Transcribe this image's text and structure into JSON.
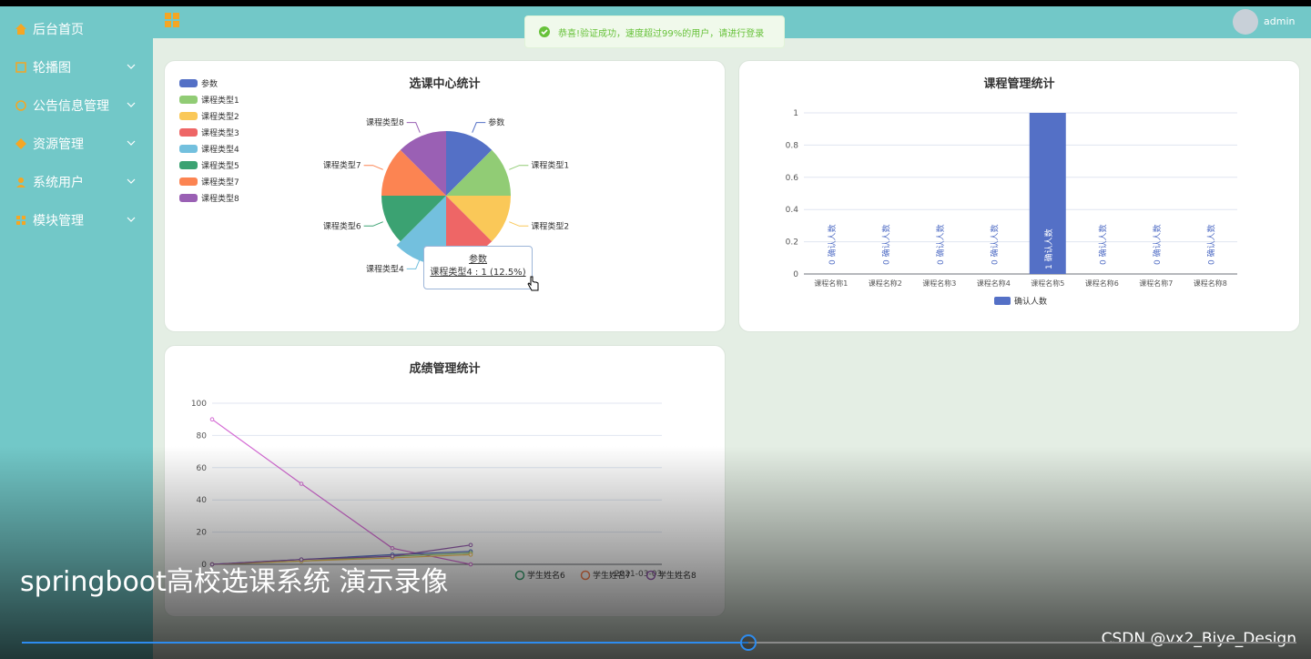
{
  "sidebar": {
    "items": [
      {
        "label": "后台首页",
        "icon": "home-icon",
        "color": "#f5a623",
        "has_chevron": false
      },
      {
        "label": "轮播图",
        "icon": "image-icon",
        "color": "#f5a623",
        "has_chevron": true
      },
      {
        "label": "公告信息管理",
        "icon": "notice-icon",
        "color": "#f5a623",
        "has_chevron": true
      },
      {
        "label": "资源管理",
        "icon": "resource-icon",
        "color": "#f5a623",
        "has_chevron": true
      },
      {
        "label": "系统用户",
        "icon": "user-icon",
        "color": "#f5a623",
        "has_chevron": true
      },
      {
        "label": "模块管理",
        "icon": "module-icon",
        "color": "#f5a623",
        "has_chevron": true
      }
    ]
  },
  "topbar": {
    "user": "admin"
  },
  "toast": {
    "text": "恭喜!验证成功，速度超过99%的用户，请进行登录"
  },
  "charts": {
    "pie": {
      "title": "选课中心统计"
    },
    "bar": {
      "title": "课程管理统计"
    },
    "line": {
      "title": "成绩管理统计"
    }
  },
  "tooltip": {
    "title": "参数",
    "text": "课程类型4 : 1 (12.5%)"
  },
  "video": {
    "title": "springboot高校选课系统 演示录像",
    "watermark": "CSDN @vx2_Biye_Design",
    "progress": 0.57
  },
  "chart_data": [
    {
      "type": "pie",
      "title": "选课中心统计",
      "categories": [
        "参数",
        "课程类型1",
        "课程类型2",
        "课程类型3",
        "课程类型4",
        "课程类型5",
        "课程类型6",
        "课程类型7"
      ],
      "pie_labels": [
        "参数",
        "课程类型1",
        "课程类型2",
        "课程类型3",
        "课程类型4",
        "课程类型6",
        "课程类型7",
        "课程类型8"
      ],
      "legend": [
        "参数",
        "课程类型1",
        "课程类型2",
        "课程类型3",
        "课程类型4",
        "课程类型5",
        "课程类型7",
        "课程类型8"
      ],
      "values": [
        1,
        1,
        1,
        1,
        1,
        1,
        1,
        1
      ],
      "colors": [
        "#5470c6",
        "#91cc75",
        "#fac858",
        "#ee6666",
        "#73c0de",
        "#3ba272",
        "#fc8452",
        "#9a60b4"
      ],
      "legend_position": "top-left"
    },
    {
      "type": "bar",
      "title": "课程管理统计",
      "categories": [
        "课程名称1",
        "课程名称2",
        "课程名称3",
        "课程名称4",
        "课程名称5",
        "课程名称6",
        "课程名称7",
        "课程名称8"
      ],
      "series": [
        {
          "name": "确认人数",
          "values": [
            0,
            0,
            0,
            0,
            1,
            0,
            0,
            0
          ],
          "color": "#5470c6"
        }
      ],
      "ylim": [
        0,
        1
      ],
      "yticks": [
        "0",
        "0.2",
        "0.4",
        "0.6",
        "0.8",
        "1"
      ],
      "grid": true,
      "legend_position": "bottom"
    },
    {
      "type": "line",
      "title": "成绩管理统计",
      "yticks": [
        "0",
        "20",
        "40",
        "60",
        "80",
        "100"
      ],
      "ylim": [
        0,
        100
      ],
      "x_label_visible": "2021-03-03",
      "series": [
        {
          "values": [
            90,
            50,
            10,
            0
          ],
          "color": "#d46ad4"
        },
        {
          "values": [
            0,
            3,
            6,
            8
          ],
          "color": "#5470c6"
        },
        {
          "values": [
            0,
            2,
            5,
            7
          ],
          "color": "#91cc75"
        },
        {
          "values": [
            0,
            2,
            4,
            6
          ],
          "color": "#fac858"
        },
        {
          "values": [
            0,
            3,
            5,
            12
          ],
          "color": "#9a60b4"
        }
      ],
      "legend_visible": [
        "学生姓名6",
        "学生姓名7",
        "学生姓名8"
      ],
      "legend_colors": [
        "#3ba272",
        "#fc8452",
        "#9a60b4"
      ],
      "grid": true
    }
  ]
}
